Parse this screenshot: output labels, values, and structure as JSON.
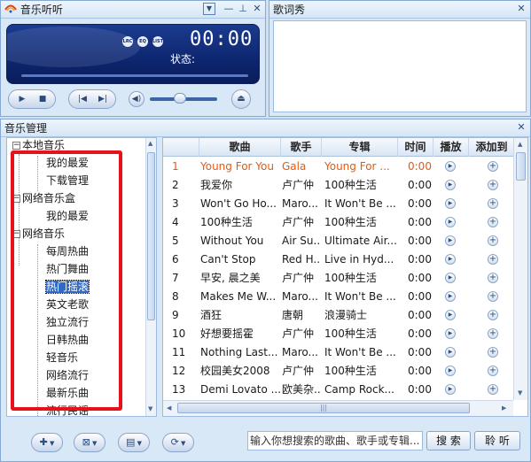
{
  "player": {
    "title": "音乐听听",
    "time": "00:00",
    "status_label": "状态:",
    "lcd_buttons": [
      "LRC",
      "EQ",
      "LIST"
    ],
    "volume_level": 0.45
  },
  "lyrics": {
    "title": "歌词秀"
  },
  "manager": {
    "title": "音乐管理"
  },
  "tree": {
    "groups": [
      {
        "label": "本地音乐",
        "toggle": "⊟",
        "items": [
          "我的最爱",
          "下载管理"
        ]
      },
      {
        "label": "网络音乐盒",
        "toggle": "⊟",
        "items": [
          "我的最爱"
        ]
      },
      {
        "label": "网络音乐",
        "toggle": "⊟",
        "items": [
          "每周热曲",
          "热门舞曲",
          "热门摇滚",
          "英文老歌",
          "独立流行",
          "日韩热曲",
          "轻音乐",
          "网络流行",
          "最新乐曲",
          "流行民谣"
        ]
      }
    ],
    "selected": "热门摇滚"
  },
  "songlist": {
    "columns": [
      "歌曲",
      "歌手",
      "专辑",
      "时间",
      "播放",
      "添加到"
    ],
    "rows": [
      {
        "no": "1",
        "song": "Young For You",
        "artist": "Gala",
        "album": "Young For ...",
        "time": "0:00"
      },
      {
        "no": "2",
        "song": "我爱你",
        "artist": "卢广仲",
        "album": "100种生活",
        "time": "0:00"
      },
      {
        "no": "3",
        "song": "Won't Go Ho...",
        "artist": "Maro...",
        "album": "It Won't Be ...",
        "time": "0:00"
      },
      {
        "no": "4",
        "song": "100种生活",
        "artist": "卢广仲",
        "album": "100种生活",
        "time": "0:00"
      },
      {
        "no": "5",
        "song": "Without You",
        "artist": "Air Su...",
        "album": "Ultimate Air...",
        "time": "0:00"
      },
      {
        "no": "6",
        "song": "Can't Stop",
        "artist": "Red H...",
        "album": "Live in Hyd...",
        "time": "0:00"
      },
      {
        "no": "7",
        "song": "早安, 晨之美",
        "artist": "卢广仲",
        "album": "100种生活",
        "time": "0:00"
      },
      {
        "no": "8",
        "song": "Makes Me W...",
        "artist": "Maro...",
        "album": "It Won't Be ...",
        "time": "0:00"
      },
      {
        "no": "9",
        "song": "酒狂",
        "artist": "唐朝",
        "album": "浪漫骑士",
        "time": "0:00"
      },
      {
        "no": "10",
        "song": "好想要摇霍",
        "artist": "卢广仲",
        "album": "100种生活",
        "time": "0:00"
      },
      {
        "no": "11",
        "song": "Nothing Last...",
        "artist": "Maro...",
        "album": "It Won't Be ...",
        "time": "0:00"
      },
      {
        "no": "12",
        "song": "校园美女2008",
        "artist": "卢广仲",
        "album": "100种生活",
        "time": "0:00"
      },
      {
        "no": "13",
        "song": "Demi Lovato ...",
        "artist": "欧美杂...",
        "album": "Camp Rock...",
        "time": "0:00"
      }
    ],
    "playing_row": 0
  },
  "search": {
    "placeholder": "输入你想搜索的歌曲、歌手或专辑...",
    "search_label": "搜 索",
    "listen_label": "聆 听"
  }
}
